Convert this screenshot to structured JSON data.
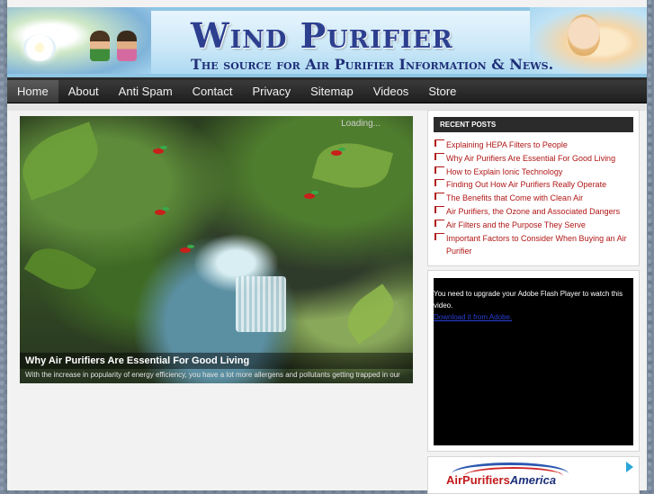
{
  "site": {
    "title": "Wind Purifier",
    "tagline": "The source for Air Purifier Information & News."
  },
  "nav": {
    "items": [
      {
        "label": "Home",
        "active": true
      },
      {
        "label": "About"
      },
      {
        "label": "Anti Spam"
      },
      {
        "label": "Contact"
      },
      {
        "label": "Privacy"
      },
      {
        "label": "Sitemap"
      },
      {
        "label": "Videos"
      },
      {
        "label": "Store"
      }
    ]
  },
  "slider": {
    "loading_text": "Loading...",
    "title": "Why Air Purifiers Are Essential For Good Living",
    "excerpt": "With the increase in popularity of energy efficiency, you have a lot more allergens and pollutants getting trapped in our"
  },
  "sidebar": {
    "recent_posts": {
      "heading": "RECENT POSTS",
      "items": [
        "Explaining HEPA Filters to People",
        "Why Air Purifiers Are Essential For Good Living",
        "How to Explain Ionic Technology",
        "Finding Out How Air Purifiers Really Operate",
        "The Benefits that Come with Clean Air",
        "Air Purifiers, the Ozone and Associated Dangers",
        "Air Filters and the Purpose They Serve",
        "Important Factors to Consider When Buying an Air Purifier"
      ]
    },
    "video": {
      "message": "You need to upgrade your Adobe Flash Player to watch this video.",
      "download_link": "Download it from Adobe."
    },
    "ad": {
      "brand_part1": "AirPurifiers",
      "brand_part2": "America"
    }
  },
  "colors": {
    "link_red": "#b01616",
    "nav_bg": "#2a2a2a",
    "title_blue": "#2d3f8f"
  }
}
